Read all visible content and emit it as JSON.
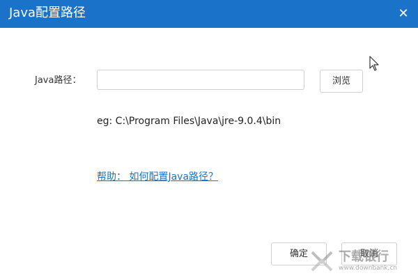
{
  "window": {
    "title": "Java配置路径",
    "close_label": "✕"
  },
  "form": {
    "path_label": "Java路径：",
    "path_value": "",
    "browse_label": "浏览",
    "example_text": "eg: C:\\Program Files\\Java\\jre-9.0.4\\bin",
    "help_link": "帮助： 如何配置Java路径？"
  },
  "footer": {
    "ok_label": "确定",
    "cancel_label": "取消"
  },
  "watermark": {
    "text": "下载银行",
    "url": "www.downbank.cn"
  },
  "colors": {
    "titlebar": "#1a73c8",
    "link": "#1a73c8",
    "background": "#ffffff"
  },
  "icons": {
    "close": "close-icon",
    "cursor": "mouse-cursor-icon",
    "watermark_logo": "downbank-logo-icon"
  }
}
